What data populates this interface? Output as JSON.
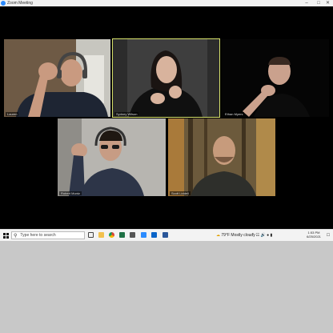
{
  "window": {
    "title": "Zoom Meeting",
    "controls": [
      "–",
      "□",
      "✕"
    ]
  },
  "participants": [
    {
      "name": "Lauren",
      "active": false
    },
    {
      "name": "Sydney Wilson",
      "active": true
    },
    {
      "name": "Ethan Myers",
      "active": false
    },
    {
      "name": "Robert Muntz",
      "active": false
    },
    {
      "name": "Scott Liddell",
      "active": false
    }
  ],
  "taskbar": {
    "search_placeholder": "Type here to search",
    "weather_temp": "79°F",
    "weather_desc": "Mostly cloudy",
    "time": "1:53 PM",
    "date": "6/25/2021"
  },
  "taskbar_icons": [
    "windows-icon",
    "search-icon",
    "task-view-icon",
    "file-explorer-icon",
    "chrome-icon",
    "excel-icon",
    "store-icon",
    "zoom-icon",
    "outlook-icon",
    "word-icon"
  ]
}
